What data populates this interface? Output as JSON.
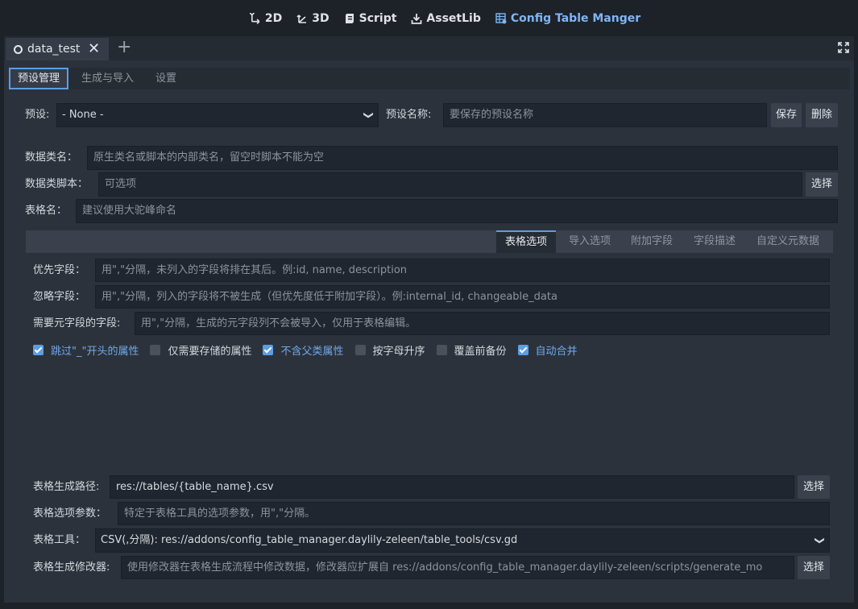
{
  "topbar": {
    "items": [
      {
        "label": "2D",
        "icon": "2d-icon"
      },
      {
        "label": "3D",
        "icon": "3d-icon"
      },
      {
        "label": "Script",
        "icon": "script-icon"
      },
      {
        "label": "AssetLib",
        "icon": "assetlib-icon"
      },
      {
        "label": "Config Table Manger",
        "icon": "config-table-icon",
        "active": true
      }
    ]
  },
  "scene_tab": {
    "label": "data_test"
  },
  "subtabs": [
    "预设管理",
    "生成与导入",
    "设置"
  ],
  "preset": {
    "label": "预设:",
    "selected": "- None -",
    "name_label": "预设名称:",
    "name_placeholder": "要保存的预设名称",
    "save": "保存",
    "delete": "删除"
  },
  "data_class": {
    "label": "数据类名：",
    "placeholder": "原生类名或脚本的内部类名，留空时脚本不能为空"
  },
  "data_script": {
    "label": "数据类脚本：",
    "placeholder": "可选项",
    "button": "选择"
  },
  "table_name": {
    "label": "表格名：",
    "placeholder": "建议使用大驼峰命名"
  },
  "inner_tabs": [
    "表格选项",
    "导入选项",
    "附加字段",
    "字段描述",
    "自定义元数据"
  ],
  "priority": {
    "label": "优先字段：",
    "placeholder": "用\",\"分隔，未列入的字段将排在其后。例:id, name, description"
  },
  "ignore": {
    "label": "忽略字段：",
    "placeholder": "用\",\"分隔，列入的字段将不被生成（但优先度低于附加字段）。例:internal_id, changeable_data"
  },
  "meta": {
    "label": "需要元字段的字段:",
    "placeholder": "用\",\"分隔，生成的元字段列不会被导入，仅用于表格编辑。"
  },
  "checkboxes": [
    {
      "label": "跳过\"_\"开头的属性",
      "checked": true
    },
    {
      "label": "仅需要存储的属性",
      "checked": false
    },
    {
      "label": "不含父类属性",
      "checked": true
    },
    {
      "label": "按字母升序",
      "checked": false
    },
    {
      "label": "覆盖前备份",
      "checked": false
    },
    {
      "label": "自动合并",
      "checked": true
    }
  ],
  "table_path": {
    "label": "表格生成路径:",
    "value": "res://tables/{table_name}.csv",
    "button": "选择"
  },
  "table_options": {
    "label": "表格选项参数：",
    "placeholder": "特定于表格工具的选项参数，用\",\"分隔。"
  },
  "table_tool": {
    "label": "表格工具：",
    "selected": "CSV(,分隔): res://addons/config_table_manager.daylily-zeleen/table_tools/csv.gd"
  },
  "modifier": {
    "label": "表格生成修改器:",
    "placeholder": "使用修改器在表格生成流程中修改数据，修改器应扩展自 res://addons/config_table_manager.daylily-zeleen/scripts/generate_mo",
    "button": "选择"
  },
  "colors": {
    "accent": "#5a9ee6",
    "active_text": "#7fb5f5",
    "background": "#1d2229",
    "panel": "#2c323b"
  }
}
